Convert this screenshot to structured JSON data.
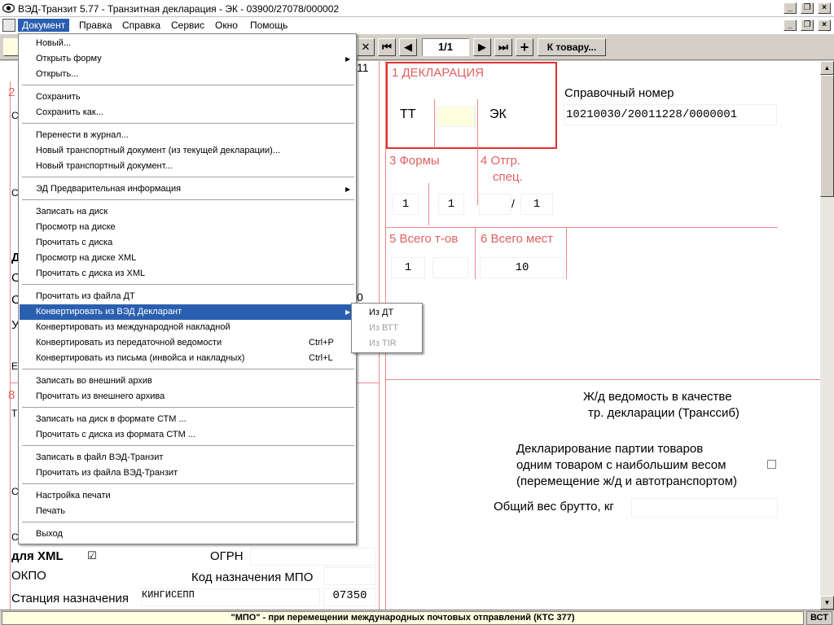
{
  "window": {
    "title": "ВЭД-Транзит 5.77  -  Транзитная декларация - ЭК - 03900/27078/000002"
  },
  "menubar": {
    "items": [
      "Документ",
      "Правка",
      "Справка",
      "Сервис",
      "Окно",
      "Помощь"
    ]
  },
  "toolbar": {
    "page": "1/1",
    "goto_label": "К товару..."
  },
  "form": {
    "box1_label": "1 ДЕКЛАРАЦИЯ",
    "box1_left": "ТТ",
    "box1_right": "ЭК",
    "ref_label": "Справочный номер",
    "ref_value": "10210030/20011228/0000001",
    "box3_label": "3 Формы",
    "box3_a": "1",
    "box3_b": "1",
    "box4_label_1": "4 Отгр.",
    "box4_label_2": "спец.",
    "box4_sep": "/",
    "box4_b": "1",
    "box5_label": "5 Всего т-ов",
    "box5_a": "1",
    "box6_label": "6 Всего мест",
    "box6_a": "10",
    "rail_line1": "Ж/д ведомость в качестве",
    "rail_line2": "тр. декларации (Транссиб)",
    "party_line1": "Декларирование партии товаров",
    "party_line2": "одним товаром с наибольшим весом",
    "party_line3": "(перемещение ж/д и автотранспортом)",
    "gross_label": "Общий вес брутто, кг",
    "left_xml_label": "для XML",
    "left_xml_check": "☑",
    "ogrn_label": "ОГРН",
    "okpo_label": "ОКПО",
    "mpo_code_label": "Код назначения МПО",
    "station_label": "Станция назначения",
    "station_value": "КИНГИСЕПП",
    "station_code": "07350",
    "left_peek": {
      "n11": "11",
      "n2": "2",
      "n8": "8",
      "c1": "С",
      "c2": "С",
      "d": "Д",
      "c3": "С",
      "c4": "С",
      "u": "У",
      "e": "Е",
      "t": "Т",
      "c5": "С",
      "c6": "С",
      "zero": "0"
    }
  },
  "menu": {
    "items": [
      {
        "label": "Новый..."
      },
      {
        "label": "Открыть форму",
        "submenu": true
      },
      {
        "label": "Открыть..."
      },
      {
        "label": "Сохранить"
      },
      {
        "label": "Сохранить как..."
      },
      {
        "label": "Перенести в журнал..."
      },
      {
        "label": "Новый транспортный документ (из текущей декларации)..."
      },
      {
        "label": "Новый транспортный документ..."
      },
      {
        "label": "ЭД Предварительная информация",
        "submenu": true
      },
      {
        "label": "Записать на диск"
      },
      {
        "label": "Просмотр на диске"
      },
      {
        "label": "Прочитать с диска"
      },
      {
        "label": "Просмотр на диске XML"
      },
      {
        "label": "Прочитать с диска из XML"
      },
      {
        "label": "Прочитать из файла ДТ"
      },
      {
        "label": "Конвертировать из ВЭД Декларант",
        "submenu": true,
        "highlighted": true
      },
      {
        "label": "Конвертировать из международной накладной"
      },
      {
        "label": "Конвертировать из передаточной ведомости",
        "shortcut": "Ctrl+P"
      },
      {
        "label": "Конвертировать из письма (инвойса и накладных)",
        "shortcut": "Ctrl+L"
      },
      {
        "label": "Записать во внешний архив"
      },
      {
        "label": "Прочитать из внешнего архива"
      },
      {
        "label": "Записать на диск в формате СТМ ..."
      },
      {
        "label": "Прочитать с диска из формата СТМ ..."
      },
      {
        "label": "Записать в файл ВЭД-Транзит"
      },
      {
        "label": "Прочитать из файла ВЭД-Транзит"
      },
      {
        "label": "Настройка печати"
      },
      {
        "label": "Печать"
      },
      {
        "label": "Выход"
      }
    ]
  },
  "submenu": {
    "items": [
      {
        "label": "Из ДТ",
        "enabled": true
      },
      {
        "label": "Из ВТТ",
        "enabled": false
      },
      {
        "label": "Из TIR",
        "enabled": false
      }
    ]
  },
  "status": {
    "message": "\"МПО\" - при перемещении международных почтовых отправлений (КТС 377)",
    "mode": "ВСТ"
  }
}
